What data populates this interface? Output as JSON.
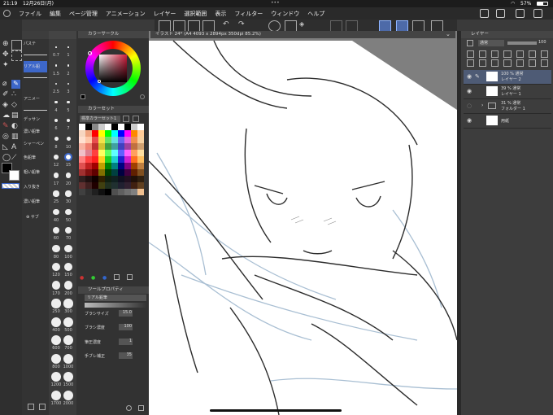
{
  "status": {
    "time": "21:19",
    "date": "12月26日(月)",
    "battery": "57%",
    "dots": "•••"
  },
  "menu": [
    "ファイル",
    "編集",
    "ページ管理",
    "アニメーション",
    "レイヤー",
    "選択範囲",
    "表示",
    "フィルター",
    "ウィンドウ",
    "ヘルプ"
  ],
  "subtool": {
    "items": [
      "パステ",
      "",
      "リアル鉛",
      "",
      "アニメー",
      "",
      "デッサン",
      "濃い鉛筆",
      "シャーペン",
      "色鉛筆",
      "粗い鉛筆",
      "入り抜き",
      "濃い鉛筆"
    ],
    "bottom_label": "サブ"
  },
  "brush_sizes": [
    "0.7",
    "1",
    "1.5",
    "2",
    "2.5",
    "3",
    "4",
    "5",
    "6",
    "7",
    "8",
    "10",
    "12",
    "15",
    "17",
    "20",
    "25",
    "30",
    "40",
    "50",
    "60",
    "70",
    "80",
    "100",
    "120",
    "150",
    "170",
    "200",
    "250",
    "300",
    "400",
    "500",
    "600",
    "700",
    "800",
    "1000",
    "1200",
    "1500",
    "1700",
    "2000"
  ],
  "color_panel": {
    "title": "カラーサークル",
    "set_title": "カラーセット",
    "set_name": "標準カラーセット1"
  },
  "canvas": {
    "tab": "イラスト 24* (A4 4093 x 2894px 350dpi 85.2%)"
  },
  "layers": {
    "title": "レイヤー",
    "blend": "通常",
    "opacity": "100",
    "rows": [
      {
        "line1": "100 % 通常",
        "line2": "レイヤー 2"
      },
      {
        "line1": "39 % 通常",
        "line2": "レイヤー 1"
      },
      {
        "line1": "31 % 通常",
        "line2": "フォルダー 1"
      },
      {
        "line1": "",
        "line2": "用紙"
      }
    ]
  },
  "tool_property": {
    "title": "ツールプロパティ",
    "tool": "リアル鉛筆",
    "props": [
      {
        "label": "ブラシサイズ",
        "value": "15.0"
      },
      {
        "label": "ブラシ濃度",
        "value": "100"
      },
      {
        "label": "筆圧濃度",
        "value": "1"
      },
      {
        "label": "手ブレ補正",
        "value": "35"
      }
    ]
  },
  "colors": {
    "accent": "#2e4a9e",
    "selected": "#4e5b75",
    "bg": "#3a3a3a"
  },
  "icons": [
    "eye-icon",
    "pen-icon",
    "eraser-icon",
    "fill-icon",
    "text-icon",
    "move-icon",
    "zoom-icon",
    "undo-icon",
    "redo-icon",
    "folder-icon",
    "trash-icon"
  ]
}
